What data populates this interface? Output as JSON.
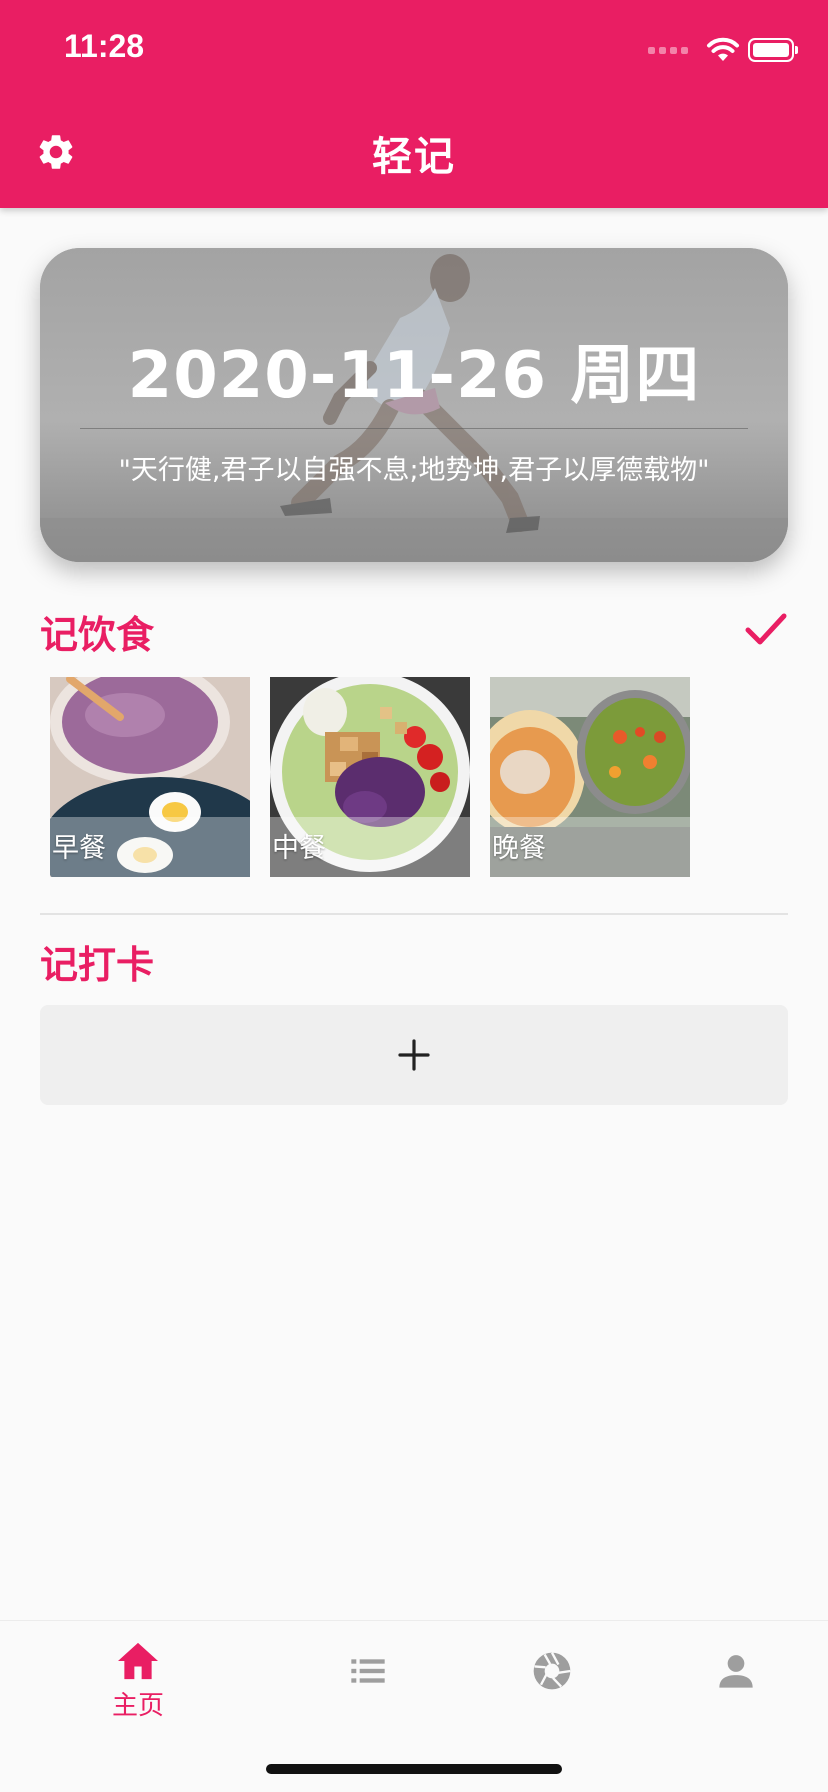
{
  "status_bar": {
    "time": "11:28"
  },
  "app_bar": {
    "title": "轻记",
    "settings_icon": "gear-icon"
  },
  "hero": {
    "date": "2020-11-26 周四",
    "quote": "\"天行健,君子以自强不息;地势坤,君子以厚德载物\""
  },
  "diet": {
    "title": "记饮食",
    "confirm_icon": "check-icon",
    "meals": [
      {
        "label": "早餐"
      },
      {
        "label": "中餐"
      },
      {
        "label": "晚餐"
      }
    ]
  },
  "checkin": {
    "title": "记打卡",
    "add_icon": "plus-icon"
  },
  "bottom_nav": {
    "items": [
      {
        "label": "主页",
        "icon": "home-icon",
        "active": true
      },
      {
        "icon": "list-icon"
      },
      {
        "icon": "camera-aperture-icon"
      },
      {
        "icon": "person-icon"
      }
    ]
  },
  "colors": {
    "accent": "#e91e63",
    "background": "#fafafa",
    "inactive_icon": "#9e9e9e"
  }
}
